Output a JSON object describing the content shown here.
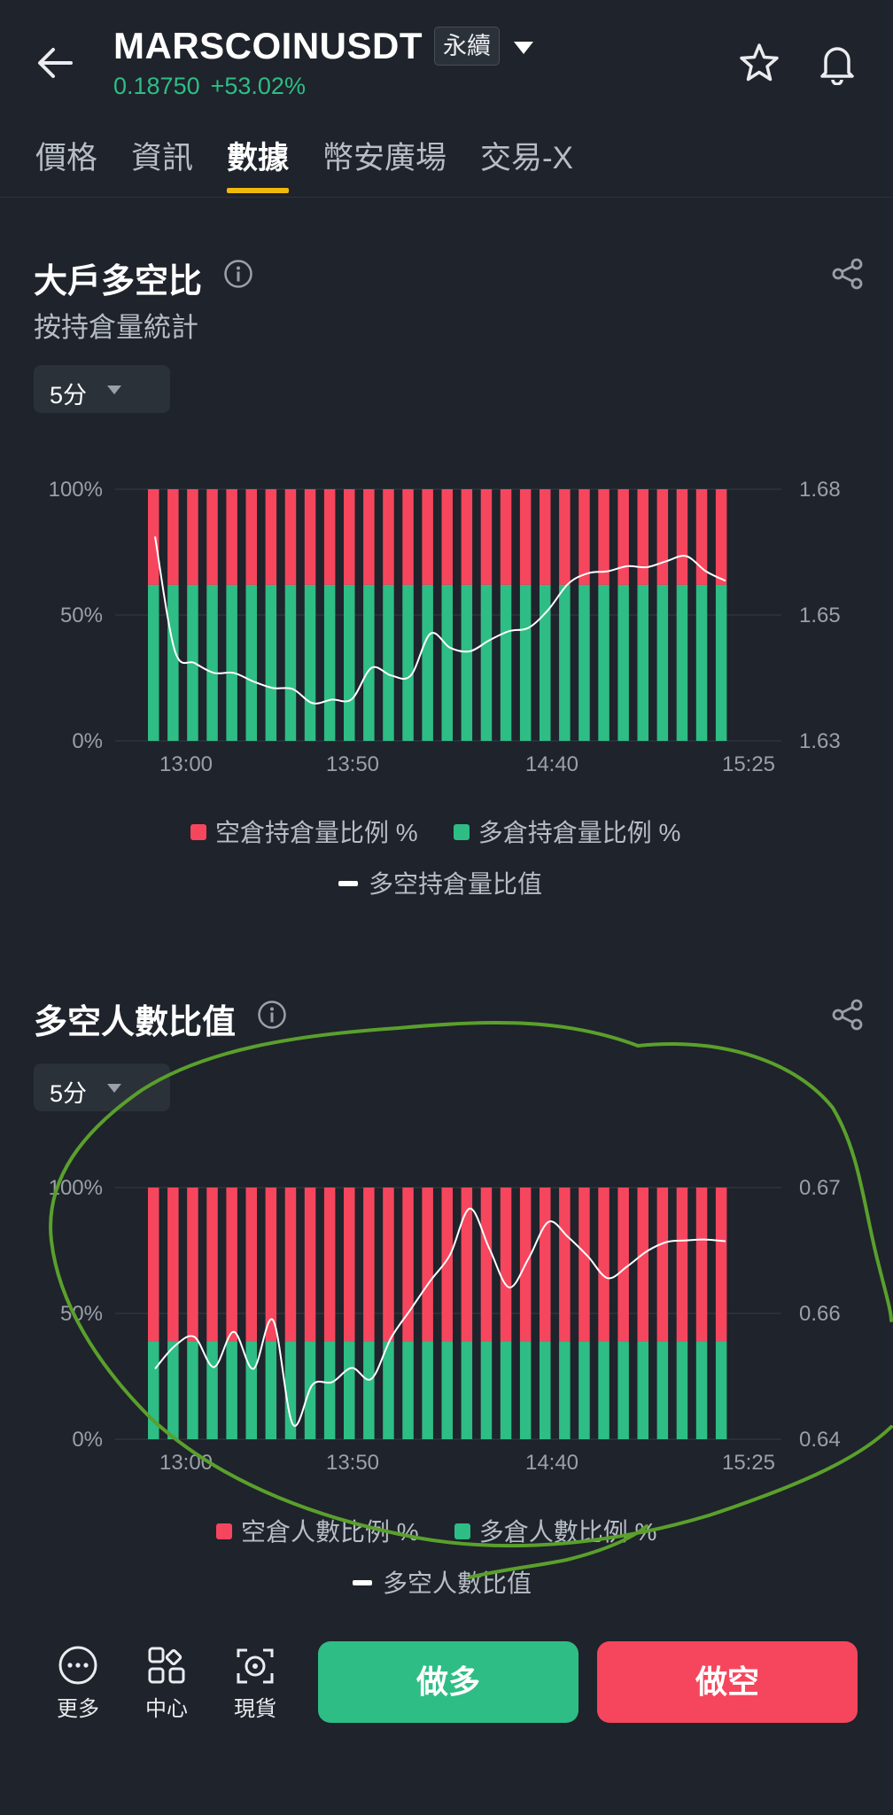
{
  "header": {
    "pair": "MARSCOINUSDT",
    "contract_tag": "永續",
    "last_price": "0.18750",
    "change_pct": "+53.02%"
  },
  "tabs": [
    {
      "label": "價格",
      "active": false
    },
    {
      "label": "資訊",
      "active": false
    },
    {
      "label": "數據",
      "active": true
    },
    {
      "label": "幣安廣場",
      "active": false
    },
    {
      "label": "交易-X",
      "active": false
    }
  ],
  "section1": {
    "title": "大戶多空比",
    "subtitle": "按持倉量統計",
    "interval": "5分",
    "legend": {
      "short": "空倉持倉量比例 %",
      "long": "多倉持倉量比例 %",
      "ratio": "多空持倉量比值"
    }
  },
  "section2": {
    "title": "多空人數比值",
    "interval": "5分",
    "legend": {
      "short": "空倉人數比例 %",
      "long": "多倉人數比例 %",
      "ratio": "多空人數比值"
    }
  },
  "bottom_nav": {
    "more": "更多",
    "center": "中心",
    "spot": "現貨",
    "long_button": "做多",
    "short_button": "做空"
  },
  "colors": {
    "long": "#2ebd85",
    "short": "#f6465d",
    "accent": "#f0b90b",
    "background": "#1f232b",
    "annotation": "#5aa02c"
  },
  "icons": [
    "back-arrow-icon",
    "caret-down-icon",
    "star-icon",
    "bell-icon",
    "info-icon",
    "share-icon",
    "more-icon",
    "grid-icon",
    "spot-icon"
  ],
  "chart_data": [
    {
      "type": "bar",
      "stacked": true,
      "x_tick_labels": [
        "13:00",
        "13:50",
        "14:40",
        "15:25"
      ],
      "left_axis_ticks": [
        "100%",
        "50%",
        "0%"
      ],
      "right_axis_ticks": [
        "1.68",
        "1.65",
        "1.63"
      ],
      "ylim_left": [
        0,
        100
      ],
      "ylim_right": [
        1.63,
        1.68
      ],
      "series": [
        {
          "name": "空倉持倉量比例 %",
          "axis": "left",
          "values": [
            38,
            38,
            38,
            38,
            38,
            38,
            38,
            38,
            38,
            38,
            38,
            38,
            38,
            38,
            38,
            38,
            38,
            38,
            38,
            38,
            38,
            38,
            38,
            38,
            38,
            38,
            38,
            38,
            38,
            38
          ]
        },
        {
          "name": "多倉持倉量比例 %",
          "axis": "left",
          "values": [
            62,
            62,
            62,
            62,
            62,
            62,
            62,
            62,
            62,
            62,
            62,
            62,
            62,
            62,
            62,
            62,
            62,
            62,
            62,
            62,
            62,
            62,
            62,
            62,
            62,
            62,
            62,
            62,
            62,
            62
          ]
        },
        {
          "name": "多空持倉量比值",
          "type": "line",
          "axis": "right",
          "values": [
            1.6706,
            1.648,
            1.6455,
            1.6435,
            1.6435,
            1.6418,
            1.6405,
            1.6403,
            1.6375,
            1.6382,
            1.6383,
            1.6445,
            1.643,
            1.643,
            1.6513,
            1.6485,
            1.6478,
            1.65,
            1.6518,
            1.6525,
            1.6561,
            1.6612,
            1.6633,
            1.6637,
            1.6647,
            1.6645,
            1.6657,
            1.6667,
            1.6637,
            1.6618
          ]
        }
      ],
      "grid": true
    },
    {
      "type": "bar",
      "stacked": true,
      "x_tick_labels": [
        "13:00",
        "13:50",
        "14:40",
        "15:25"
      ],
      "left_axis_ticks": [
        "100%",
        "50%",
        "0%"
      ],
      "right_axis_ticks": [
        "0.67",
        "0.66",
        "0.64"
      ],
      "ylim_left": [
        0,
        100
      ],
      "ylim_right": [
        0.64,
        0.67
      ],
      "series": [
        {
          "name": "空倉人數比例 %",
          "axis": "left",
          "values": [
            61,
            61,
            61,
            61,
            61,
            61,
            61,
            61,
            61,
            61,
            61,
            61,
            61,
            61,
            61,
            61,
            61,
            61,
            61,
            61,
            61,
            61,
            61,
            61,
            61,
            61,
            61,
            61,
            61,
            61
          ]
        },
        {
          "name": "多倉人數比例 %",
          "axis": "left",
          "values": [
            39,
            39,
            39,
            39,
            39,
            39,
            39,
            39,
            39,
            39,
            39,
            39,
            39,
            39,
            39,
            39,
            39,
            39,
            39,
            39,
            39,
            39,
            39,
            39,
            39,
            39,
            39,
            39,
            39,
            39
          ]
        },
        {
          "name": "多空人數比值",
          "type": "line",
          "axis": "right",
          "values": [
            0.6484,
            0.6511,
            0.6522,
            0.6486,
            0.6528,
            0.6484,
            0.6542,
            0.6418,
            0.6465,
            0.6468,
            0.6485,
            0.6472,
            0.6521,
            0.6555,
            0.6589,
            0.662,
            0.6675,
            0.6627,
            0.6581,
            0.6616,
            0.6659,
            0.6641,
            0.6618,
            0.6592,
            0.6606,
            0.6624,
            0.6635,
            0.6637,
            0.6638,
            0.6636
          ]
        }
      ],
      "grid": true
    }
  ]
}
